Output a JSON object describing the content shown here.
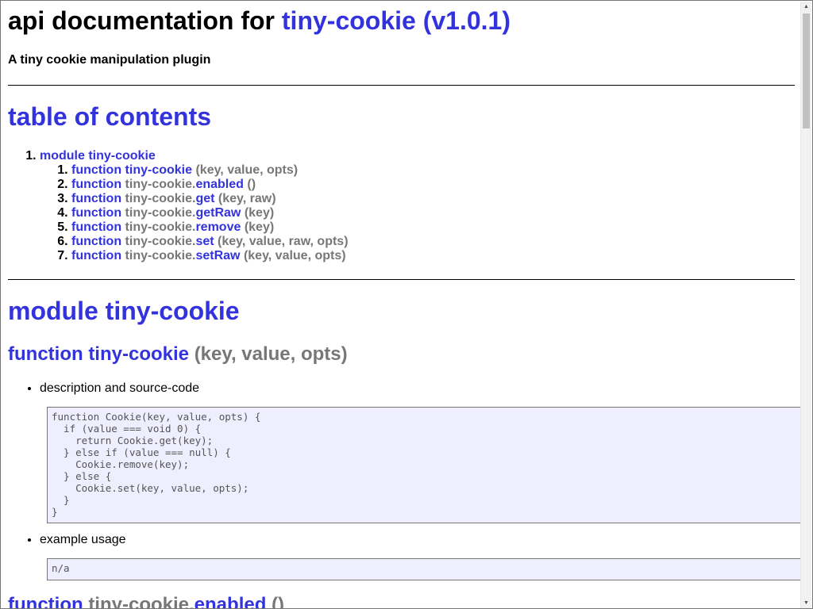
{
  "header": {
    "title_prefix": "api documentation for ",
    "title_link": "tiny-cookie (v1.0.1)",
    "description": "A tiny cookie manipulation plugin"
  },
  "toc": {
    "title": "table of contents",
    "module_label": "module tiny-cookie",
    "items": [
      {
        "keyword": "function",
        "prefix": "",
        "name": "tiny-cookie",
        "args": "(key, value, opts)"
      },
      {
        "keyword": "function",
        "prefix": "tiny-cookie.",
        "name": "enabled",
        "args": "()"
      },
      {
        "keyword": "function",
        "prefix": "tiny-cookie.",
        "name": "get",
        "args": "(key, raw)"
      },
      {
        "keyword": "function",
        "prefix": "tiny-cookie.",
        "name": "getRaw",
        "args": "(key)"
      },
      {
        "keyword": "function",
        "prefix": "tiny-cookie.",
        "name": "remove",
        "args": "(key)"
      },
      {
        "keyword": "function",
        "prefix": "tiny-cookie.",
        "name": "set",
        "args": "(key, value, raw, opts)"
      },
      {
        "keyword": "function",
        "prefix": "tiny-cookie.",
        "name": "setRaw",
        "args": "(key, value, opts)"
      }
    ]
  },
  "module": {
    "title": "module tiny-cookie",
    "functions": [
      {
        "keyword": "function",
        "prefix": "",
        "name": "tiny-cookie",
        "args": "(key, value, opts)",
        "source_label": "description and source-code",
        "source": "function Cookie(key, value, opts) {\n  if (value === void 0) {\n    return Cookie.get(key);\n  } else if (value === null) {\n    Cookie.remove(key);\n  } else {\n    Cookie.set(key, value, opts);\n  }\n}",
        "example_label": "example usage",
        "example": "n/a"
      },
      {
        "keyword": "function",
        "prefix": "tiny-cookie.",
        "name": "enabled",
        "args": "()"
      }
    ]
  },
  "colors": {
    "link": "#3333dd",
    "muted": "#777777",
    "code_bg": "#eeeeff"
  },
  "icons": {
    "scroll_up": "triangle-up-icon",
    "scroll_down": "triangle-down-icon"
  }
}
